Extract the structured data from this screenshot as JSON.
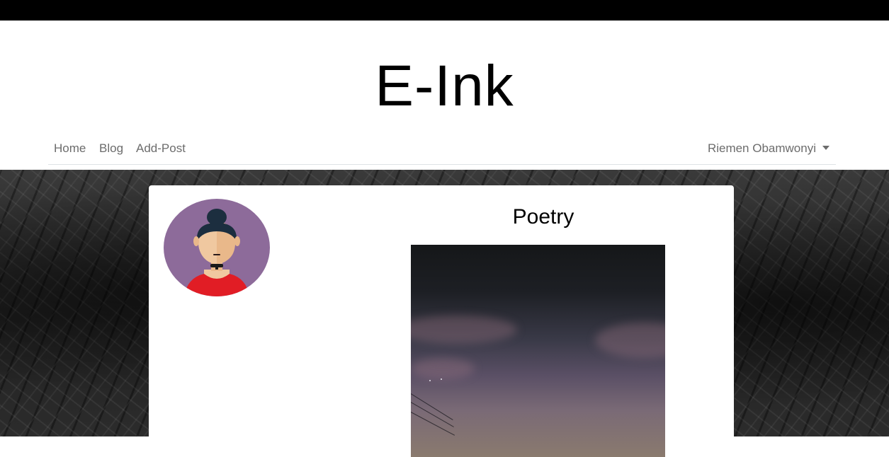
{
  "site": {
    "title": "E-Ink"
  },
  "nav": {
    "links": [
      "Home",
      "Blog",
      "Add-Post"
    ],
    "user": "Riemen Obamwonyi"
  },
  "post": {
    "title": "Poetry"
  },
  "colors": {
    "topbar": "#000000",
    "nav_text": "#6c6c6c",
    "avatar_bg": "#8d6b9a",
    "avatar_hair": "#1c2e3f",
    "avatar_skin": "#f0c8a0",
    "avatar_top": "#e11d25"
  }
}
